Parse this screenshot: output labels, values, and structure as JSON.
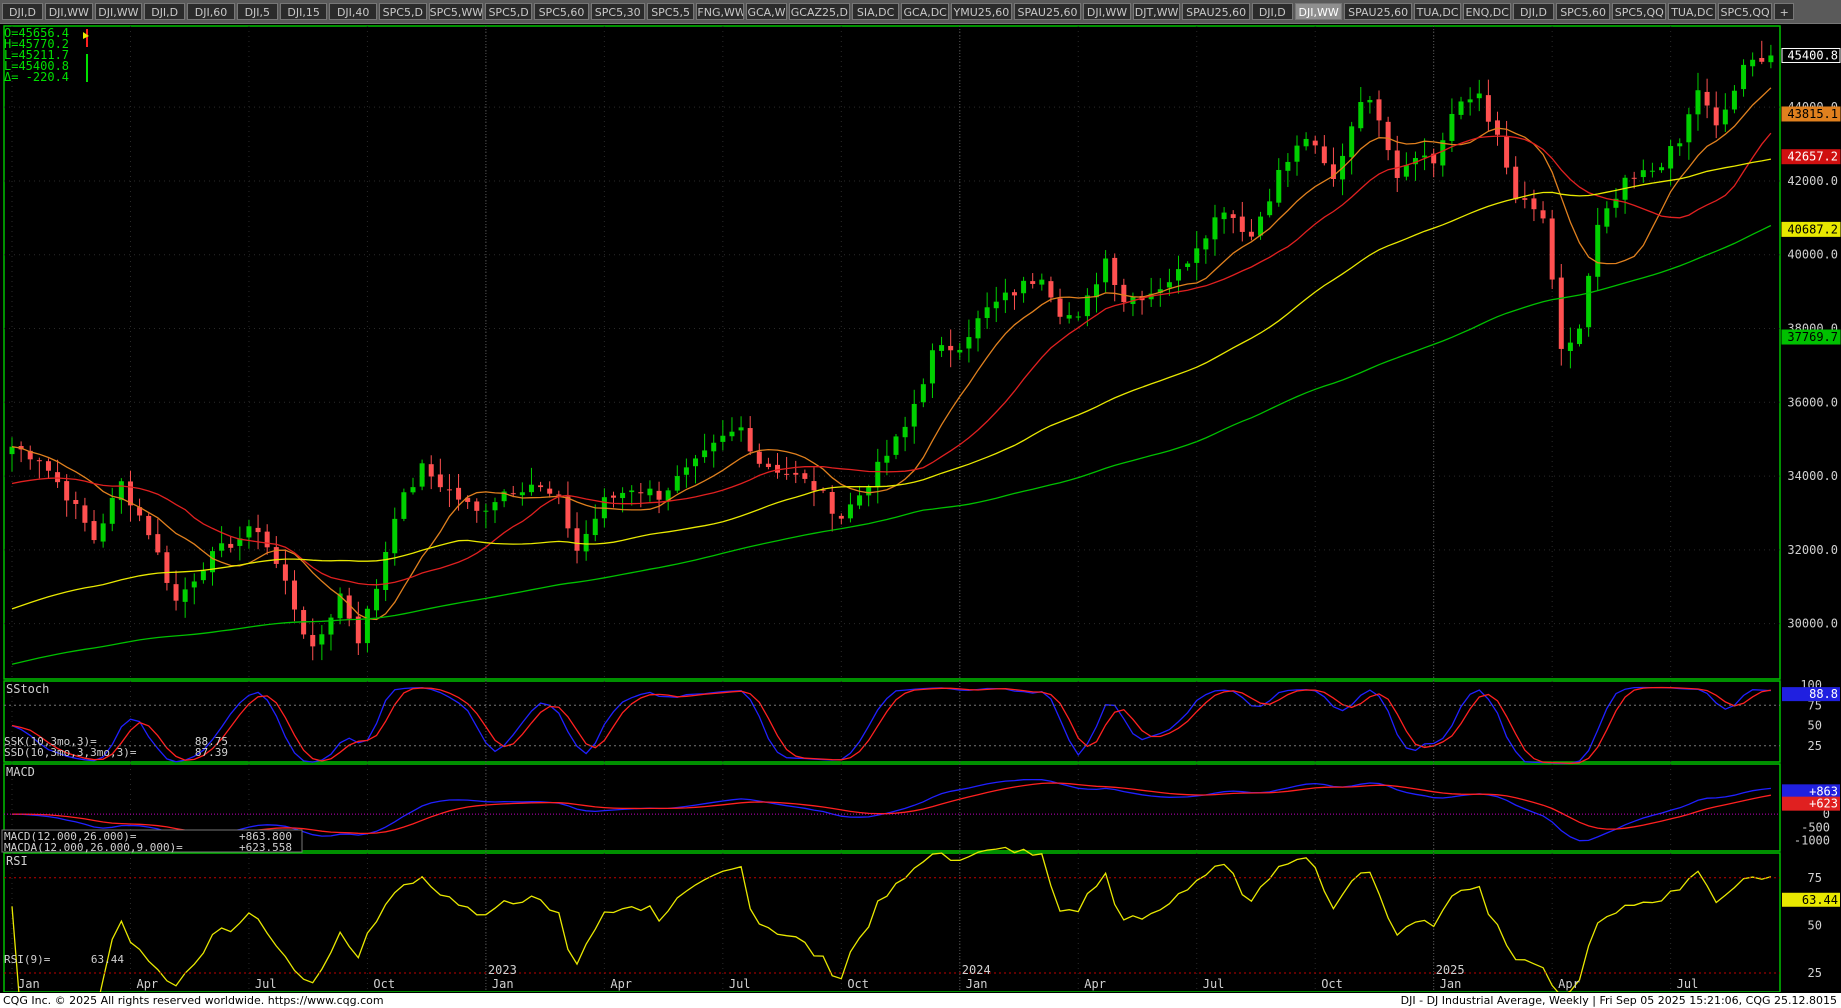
{
  "tabs": [
    "DJI,D",
    "DJI,WW",
    "DJI,WW",
    "DJI,D",
    "DJI,60",
    "DJI,5",
    "DJI,15",
    "DJI,40",
    "SPC5,D",
    "SPC5,WW",
    "SPC5,D",
    "SPC5,60",
    "SPC5,30",
    "SPC5,5",
    "FNG,WW",
    "GCA,W",
    "GCAZ25,D",
    "SIA,DC",
    "GCA,DC",
    "YMU25,60",
    "SPAU25,60",
    "DJI,WW",
    "DJT,WW",
    "SPAU25,60",
    "DJI,D",
    "DJI,WW",
    "SPAU25,60",
    "TUA,DC",
    "ENQ,DC",
    "DJI,D",
    "SPC5,60",
    "SPC5,QQ",
    "TUA,DC",
    "SPC5,QQ",
    "+"
  ],
  "active_tab_index": 25,
  "ohlc": {
    "open": "O=45656.4",
    "high": "H=45770.2",
    "low": "L=45211.7",
    "last": "L=45400.8",
    "delta": "Δ= -220.4"
  },
  "price_axis": {
    "ticks": [
      "44000.0",
      "42000.0",
      "40000.0",
      "38000.0",
      "36000.0",
      "34000.0",
      "32000.0",
      "30000.0"
    ],
    "markers": [
      {
        "label": "45400.8",
        "value": 45400.8,
        "bg": "#000000",
        "fg": "#ffffff",
        "border": "#ffffff"
      },
      {
        "label": "43815.1",
        "value": 43815.1,
        "bg": "#e0801e",
        "fg": "#000000"
      },
      {
        "label": "42657.2",
        "value": 42657.2,
        "bg": "#d01010",
        "fg": "#ffffff"
      },
      {
        "label": "40687.2",
        "value": 40687.2,
        "bg": "#e8e800",
        "fg": "#000000"
      },
      {
        "label": "37769.7",
        "value": 37769.7,
        "bg": "#00c000",
        "fg": "#000000"
      }
    ]
  },
  "time_axis": {
    "labels": [
      {
        "text": "Jan",
        "week": 0
      },
      {
        "text": "Apr",
        "week": 13
      },
      {
        "text": "Jul",
        "week": 26
      },
      {
        "text": "Oct",
        "week": 39
      },
      {
        "text": "Jan",
        "week": 52
      },
      {
        "text": "Apr",
        "week": 65
      },
      {
        "text": "Jul",
        "week": 78
      },
      {
        "text": "Oct",
        "week": 91
      },
      {
        "text": "Jan",
        "week": 104
      },
      {
        "text": "Apr",
        "week": 117
      },
      {
        "text": "Jul",
        "week": 130
      },
      {
        "text": "Oct",
        "week": 143
      },
      {
        "text": "Jan",
        "week": 156
      },
      {
        "text": "Apr",
        "week": 169
      },
      {
        "text": "Jul",
        "week": 182
      }
    ],
    "years": [
      {
        "text": "2023",
        "week": 52
      },
      {
        "text": "2024",
        "week": 104
      },
      {
        "text": "2025",
        "week": 156
      }
    ]
  },
  "sstoch": {
    "title": "SStoch",
    "ssk_label": "SSK(10,3mo,3)=",
    "ssk_value": "88.75",
    "ssd_label": "SSD(10,3mo,3,3mo,3)=",
    "ssd_value": "87.39",
    "axis": [
      "100",
      "75",
      "50",
      "25"
    ],
    "marker": "88.8"
  },
  "macd": {
    "title": "MACD",
    "macd_label": "MACD(12.000,26.000)=",
    "macd_value": "+863.800",
    "macda_label": "MACDA(12.000,26.000,9.000)=",
    "macda_value": "+623.558",
    "axis": [
      "0",
      "-500",
      "-1000"
    ],
    "marker_macd": "+863",
    "marker_macda": "+623"
  },
  "rsi": {
    "title": "RSI",
    "label": "RSI(9)=",
    "value": "63.44",
    "axis": [
      "75",
      "50",
      "25"
    ],
    "marker": "63.44"
  },
  "footer": {
    "left": "CQG Inc. © 2025 All rights reserved worldwide. https://www.cqg.com",
    "right": "DJI - DJ Industrial Average, Weekly | Fri Sep 05 2025 15:21:06, CQG 25.12.8015"
  },
  "colors": {
    "up": "#00d000",
    "down": "#ff5050",
    "ma10": "#e0801e",
    "ma20": "#e02020",
    "ma50": "#e8e800",
    "ma100": "#00c000",
    "panel_border": "#00c000",
    "blue_line": "#2020ff",
    "red_line": "#ff2020",
    "rsi_line": "#e8e800"
  },
  "chart_data": {
    "type": "candlestick",
    "title": "DJI - DJ Industrial Average, Weekly",
    "ylim": [
      28500,
      46200
    ],
    "anchors": [
      [
        0,
        34800
      ],
      [
        3,
        34500
      ],
      [
        6,
        33500
      ],
      [
        9,
        32300
      ],
      [
        12,
        33800
      ],
      [
        15,
        32500
      ],
      [
        18,
        30600
      ],
      [
        21,
        31600
      ],
      [
        24,
        32200
      ],
      [
        27,
        32600
      ],
      [
        30,
        31100
      ],
      [
        33,
        29200
      ],
      [
        36,
        30800
      ],
      [
        38,
        29600
      ],
      [
        40,
        31000
      ],
      [
        42,
        33000
      ],
      [
        45,
        34200
      ],
      [
        48,
        33600
      ],
      [
        51,
        33000
      ],
      [
        54,
        33600
      ],
      [
        57,
        33800
      ],
      [
        60,
        33300
      ],
      [
        62,
        32000
      ],
      [
        65,
        33300
      ],
      [
        68,
        33700
      ],
      [
        71,
        33500
      ],
      [
        75,
        34300
      ],
      [
        78,
        35000
      ],
      [
        80,
        35300
      ],
      [
        82,
        34400
      ],
      [
        85,
        34100
      ],
      [
        88,
        33700
      ],
      [
        91,
        32900
      ],
      [
        93,
        33500
      ],
      [
        95,
        34200
      ],
      [
        98,
        35300
      ],
      [
        101,
        37300
      ],
      [
        104,
        37600
      ],
      [
        107,
        38500
      ],
      [
        110,
        39000
      ],
      [
        113,
        39500
      ],
      [
        115,
        38500
      ],
      [
        117,
        38200
      ],
      [
        120,
        39900
      ],
      [
        122,
        38800
      ],
      [
        125,
        39000
      ],
      [
        128,
        39500
      ],
      [
        130,
        40300
      ],
      [
        133,
        41300
      ],
      [
        136,
        40500
      ],
      [
        139,
        42200
      ],
      [
        142,
        43200
      ],
      [
        145,
        42000
      ],
      [
        148,
        44300
      ],
      [
        150,
        43800
      ],
      [
        152,
        42200
      ],
      [
        154,
        42800
      ],
      [
        156,
        42500
      ],
      [
        158,
        43800
      ],
      [
        161,
        44400
      ],
      [
        163,
        43100
      ],
      [
        165,
        41500
      ],
      [
        168,
        41000
      ],
      [
        170,
        37300
      ],
      [
        172,
        38000
      ],
      [
        174,
        40700
      ],
      [
        177,
        41900
      ],
      [
        180,
        42300
      ],
      [
        183,
        43000
      ],
      [
        185,
        44500
      ],
      [
        187,
        43400
      ],
      [
        190,
        45000
      ],
      [
        192,
        45400
      ]
    ]
  }
}
